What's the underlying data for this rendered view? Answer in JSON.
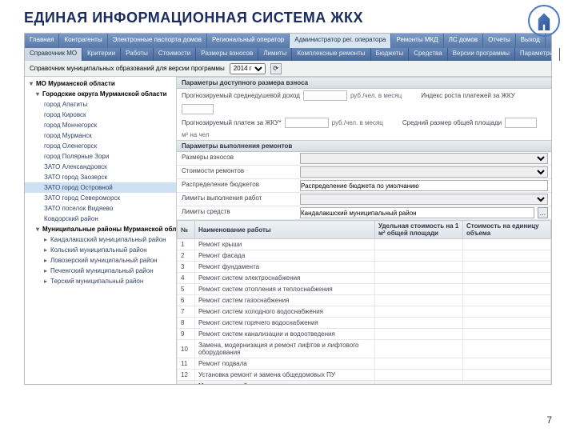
{
  "slide": {
    "title": "ЕДИНАЯ ИНФОРМАЦИОННАЯ СИСТЕМА ЖКХ",
    "page": "7"
  },
  "topnav": {
    "items": [
      "Главная",
      "Контрагенты",
      "Электронные паспорта домов",
      "Региональный оператор",
      "Администратор рег. оператора",
      "Ремонты МКД",
      "ЛС домов",
      "Отчеты",
      "Выход"
    ],
    "active_index": 4
  },
  "subnav": {
    "items": [
      "Справочник МО",
      "Критерии",
      "Работы",
      "Стоимости",
      "Размеры взносов",
      "Лимиты",
      "Комплексные ремонты",
      "Бюджеты",
      "Средства",
      "Версии программы",
      "Параметры"
    ],
    "active_index": 0
  },
  "filter": {
    "label": "Справочник муниципальных образований для версии программы",
    "year_options": [
      "2014 г"
    ],
    "year_selected": "2014 г"
  },
  "tree": [
    {
      "lvl": 1,
      "open": true,
      "label": "МО Мурманской области"
    },
    {
      "lvl": 2,
      "open": true,
      "label": "Городские округа Мурманской области"
    },
    {
      "lvl": 3,
      "label": "город Апатиты"
    },
    {
      "lvl": 3,
      "label": "город Кировск"
    },
    {
      "lvl": 3,
      "label": "город Мончегорск"
    },
    {
      "lvl": 3,
      "label": "город Мурманск"
    },
    {
      "lvl": 3,
      "label": "город Оленегорск"
    },
    {
      "lvl": 3,
      "label": "город Полярные Зори"
    },
    {
      "lvl": 3,
      "label": "ЗАТО Александровск"
    },
    {
      "lvl": 3,
      "label": "ЗАТО город Заозерск"
    },
    {
      "lvl": 3,
      "label": "ЗАТО город Островной",
      "sel": true
    },
    {
      "lvl": 3,
      "label": "ЗАТО город Североморск"
    },
    {
      "lvl": 3,
      "label": "ЗАТО поселок Видяево"
    },
    {
      "lvl": 3,
      "label": "Ковдорский район"
    },
    {
      "lvl": 2,
      "open": true,
      "label": "Муниципальные районы Мурманской области"
    },
    {
      "lvl": 3,
      "tri": true,
      "label": "Кандалакшский муниципальный район"
    },
    {
      "lvl": 3,
      "tri": true,
      "label": "Кольский муниципальный район"
    },
    {
      "lvl": 3,
      "tri": true,
      "label": "Ловозерский муниципальный район"
    },
    {
      "lvl": 3,
      "tri": true,
      "label": "Печенгский муниципальный район"
    },
    {
      "lvl": 3,
      "tri": true,
      "label": "Терский муниципальный район"
    }
  ],
  "sections": {
    "s1": "Параметры доступного размера взноса",
    "s2": "Параметры выполнения ремонтов"
  },
  "params": {
    "income_label": "Прогнозируемый среднедушевой доход",
    "income_unit": "руб./чел. в месяц",
    "index_label": "Индекс роста платежей за ЖКУ",
    "pay_label": "Прогнозируемый платеж за ЖКУ*",
    "pay_unit": "руб./чел. в месяц",
    "avg_area_label": "Средний размер общей площади",
    "avg_area_unit": "м² на чел"
  },
  "repair_params": {
    "rows": [
      {
        "k": "Размеры взносов",
        "type": "select"
      },
      {
        "k": "Стоимости ремонтов",
        "type": "select"
      },
      {
        "k": "Распределение бюджетов",
        "type": "text",
        "v": "Распределение бюджета по умолчанию"
      },
      {
        "k": "Лимиты выполнения работ",
        "type": "select"
      },
      {
        "k": "Лимиты средств",
        "type": "text",
        "v": "Кандалакшский муниципальный район",
        "btn": true
      }
    ]
  },
  "table": {
    "headers": [
      "№",
      "Наименование работы",
      "Удельная стоимость на 1 м² общей площади",
      "Стоимость на единицу объема"
    ],
    "rows": [
      {
        "n": "1",
        "name": "Ремонт крыши"
      },
      {
        "n": "2",
        "name": "Ремонт фасада"
      },
      {
        "n": "3",
        "name": "Ремонт фундамента"
      },
      {
        "n": "4",
        "name": "Ремонт систем электроснабжения"
      },
      {
        "n": "5",
        "name": "Ремонт систем отопления и теплоснабжения"
      },
      {
        "n": "6",
        "name": "Ремонт систем газоснабжения"
      },
      {
        "n": "7",
        "name": "Ремонт систем холодного водоснабжения"
      },
      {
        "n": "8",
        "name": "Ремонт систем горячего водоснабжения"
      },
      {
        "n": "9",
        "name": "Ремонт систем канализации и водоотведения"
      },
      {
        "n": "10",
        "name": "Замена, модернизация и ремонт лифтов и лифтового оборудования"
      },
      {
        "n": "11",
        "name": "Ремонт подвала"
      },
      {
        "n": "12",
        "name": "Установка ремонт и замена общедомовых ПУ"
      }
    ],
    "total_label": "Максимальный итог"
  }
}
